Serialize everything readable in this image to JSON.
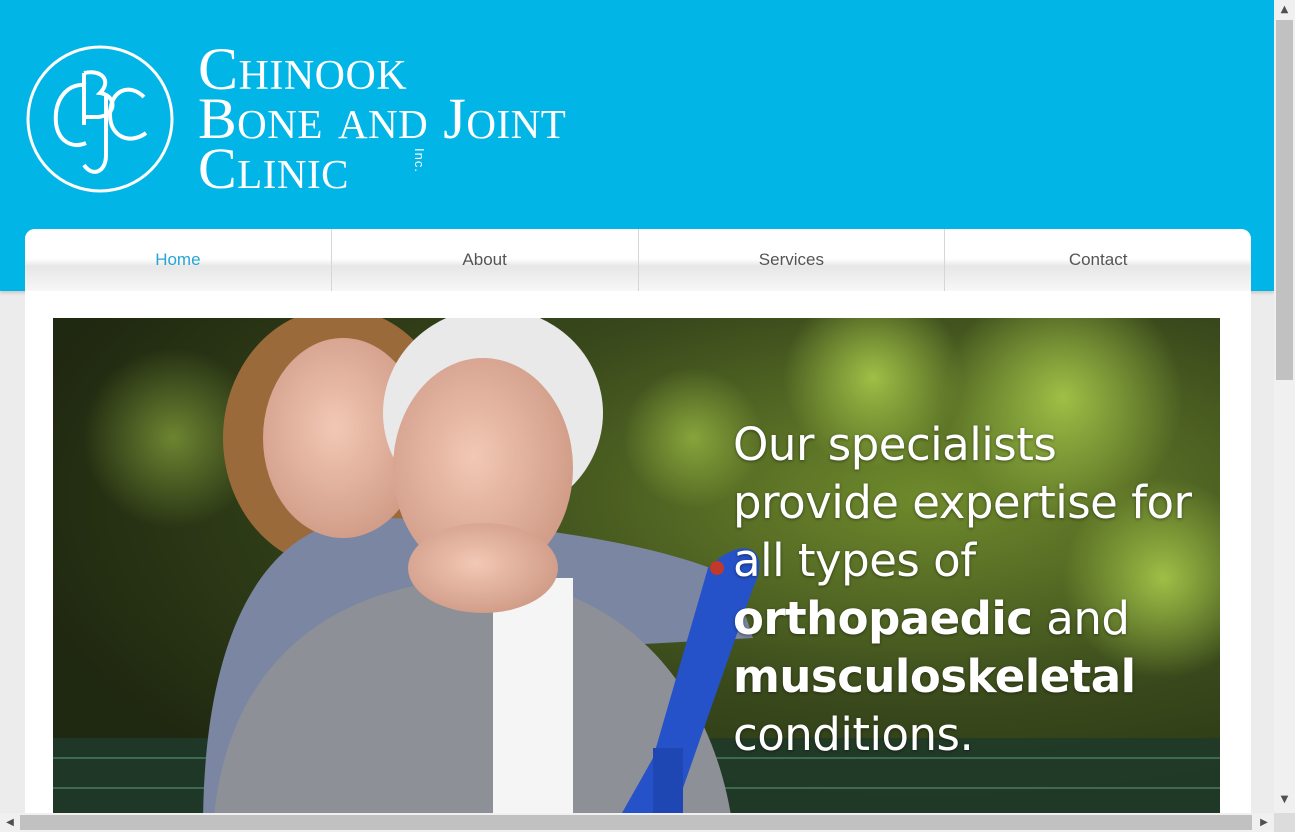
{
  "brand": {
    "monogram": "CBJC",
    "line1": "Chinook",
    "line2": "Bone and Joint",
    "line3": "Clinic",
    "suffix": "Inc.",
    "header_color": "#01b5e6"
  },
  "nav": {
    "items": [
      {
        "label": "Home",
        "active": true
      },
      {
        "label": "About",
        "active": false
      },
      {
        "label": "Services",
        "active": false
      },
      {
        "label": "Contact",
        "active": false
      }
    ],
    "active_color": "#28a5d6"
  },
  "hero": {
    "text_part1": "Our specialists provide expertise for all types of ",
    "bold1": "orthopaedic",
    "text_part2": " and ",
    "bold2": "musculoskeletal",
    "text_part3": " conditions."
  },
  "scrollbars": {
    "up_arrow_icon": "triangle-up",
    "down_arrow_icon": "triangle-down",
    "left_arrow_icon": "triangle-left",
    "right_arrow_icon": "triangle-right"
  }
}
